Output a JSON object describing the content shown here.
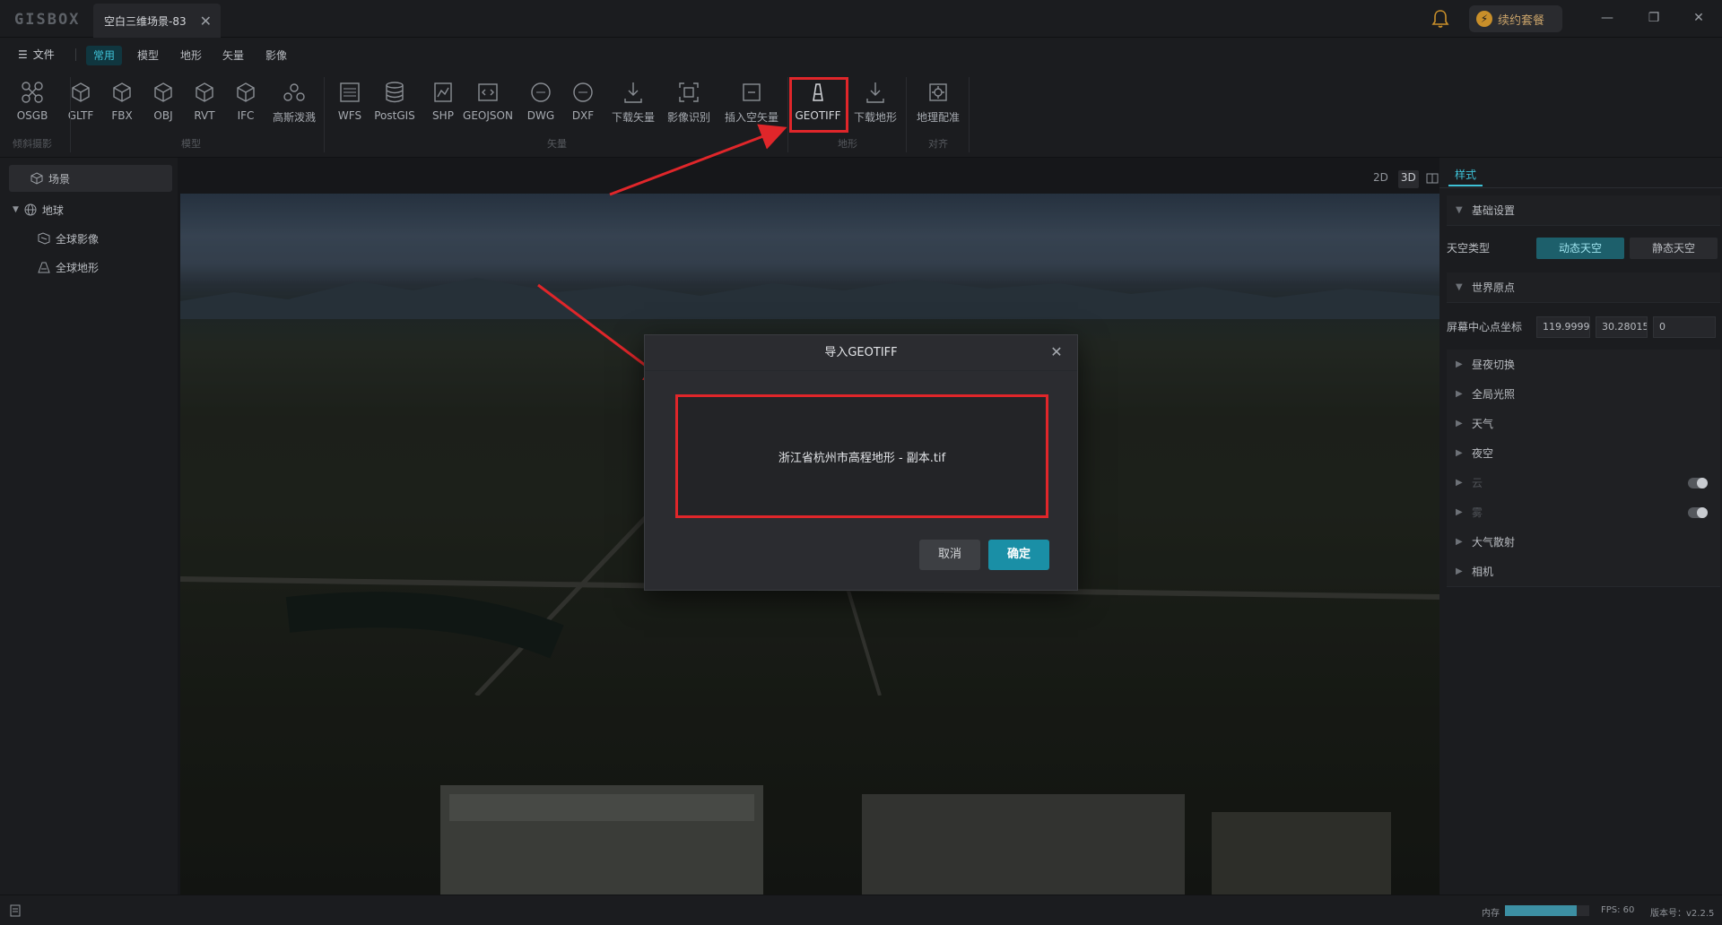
{
  "titlebar": {
    "logo": "GISBOX",
    "tab_title": "空白三维场景-83",
    "renew_label": "续约套餐"
  },
  "menubar": {
    "file_label": "文件",
    "tabs": [
      {
        "label": "常用",
        "active": true
      },
      {
        "label": "模型",
        "active": false
      },
      {
        "label": "地形",
        "active": false
      },
      {
        "label": "矢量",
        "active": false
      },
      {
        "label": "影像",
        "active": false
      }
    ]
  },
  "toolbar": {
    "tools": [
      {
        "label": "OSGB",
        "icon": "drone-icon"
      },
      {
        "label": "GLTF",
        "icon": "cube-icon"
      },
      {
        "label": "FBX",
        "icon": "cube-icon"
      },
      {
        "label": "OBJ",
        "icon": "cube-icon"
      },
      {
        "label": "RVT",
        "icon": "cube-icon"
      },
      {
        "label": "IFC",
        "icon": "cube-icon"
      },
      {
        "label": "高斯泼溅",
        "icon": "gaussian-icon"
      },
      {
        "label": "WFS",
        "icon": "wfs-icon"
      },
      {
        "label": "PostGIS",
        "icon": "database-icon"
      },
      {
        "label": "SHP",
        "icon": "shp-icon"
      },
      {
        "label": "GEOJSON",
        "icon": "geojson-icon"
      },
      {
        "label": "DWG",
        "icon": "dwg-icon"
      },
      {
        "label": "DXF",
        "icon": "dxf-icon"
      },
      {
        "label": "下载矢量",
        "icon": "download-vector-icon"
      },
      {
        "label": "影像识别",
        "icon": "image-recognition-icon"
      },
      {
        "label": "插入空矢量",
        "icon": "empty-vector-icon"
      },
      {
        "label": "GEOTIFF",
        "icon": "geotiff-icon",
        "highlighted": true
      },
      {
        "label": "下载地形",
        "icon": "download-terrain-icon"
      },
      {
        "label": "地理配准",
        "icon": "georeference-icon"
      }
    ],
    "groups": [
      "倾斜摄影",
      "模型",
      "矢量",
      "地形",
      "对齐"
    ]
  },
  "left_panel": {
    "scene_label": "场景",
    "earth_label": "地球",
    "children": [
      "全球影像",
      "全球地形"
    ]
  },
  "view_toggles": [
    "2D",
    "3D"
  ],
  "right_panel": {
    "tab": "样式",
    "basic_settings": "基础设置",
    "sky_type_label": "天空类型",
    "sky_options": [
      "动态天空",
      "静态天空"
    ],
    "world_origin": "世界原点",
    "screen_center_label": "屏幕中心点坐标",
    "coords": [
      "119.9999",
      "30.28015",
      "0"
    ],
    "sections": [
      {
        "label": "昼夜切换",
        "dim": false,
        "toggle": false
      },
      {
        "label": "全局光照",
        "dim": false,
        "toggle": false
      },
      {
        "label": "天气",
        "dim": false,
        "toggle": false
      },
      {
        "label": "夜空",
        "dim": false,
        "toggle": false
      },
      {
        "label": "云",
        "dim": true,
        "toggle": true
      },
      {
        "label": "雾",
        "dim": true,
        "toggle": true
      },
      {
        "label": "大气散射",
        "dim": false,
        "toggle": false
      },
      {
        "label": "相机",
        "dim": false,
        "toggle": false
      }
    ]
  },
  "dialog": {
    "title": "导入GEOTIFF",
    "filename": "浙江省杭州市高程地形 - 副本.tif",
    "cancel_label": "取消",
    "ok_label": "确定"
  },
  "statusbar": {
    "memory_label": "内存",
    "memory_fraction": 0.85,
    "fps": "FPS: 60",
    "version": "版本号：v2.2.5"
  },
  "colors": {
    "accent": "#3ec1d6",
    "highlight": "#e0262a",
    "ok_button": "#1a8fa6"
  }
}
